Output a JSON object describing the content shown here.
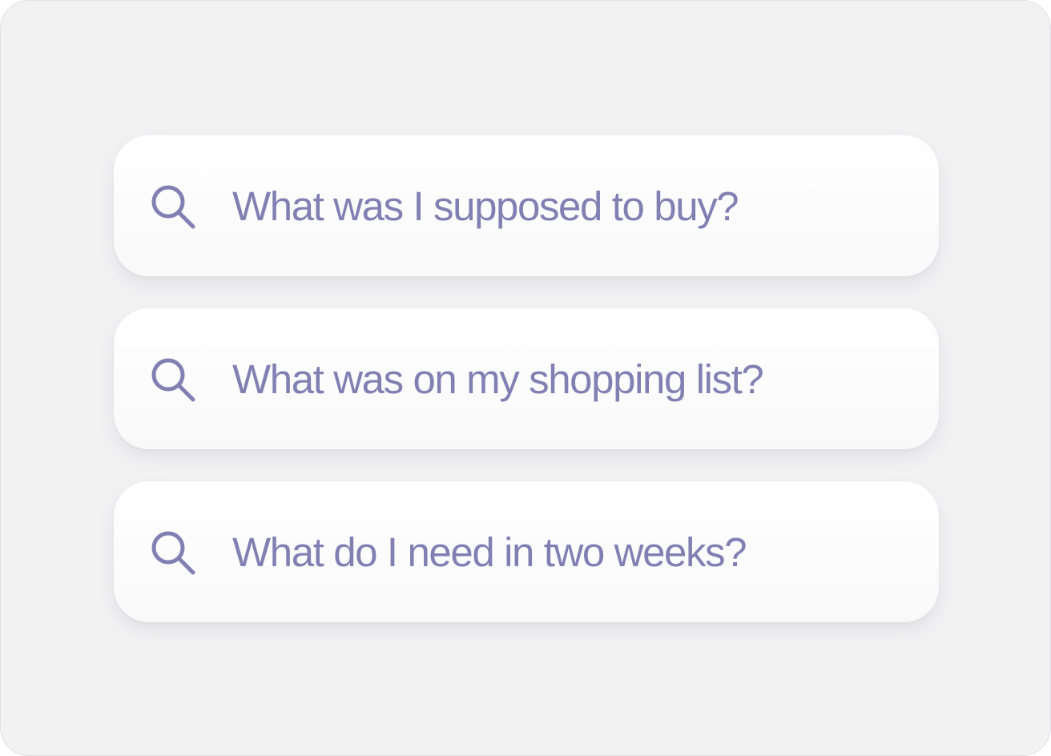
{
  "accent_color": "#8180b3",
  "searches": [
    {
      "icon": "search-icon",
      "query": "What was I supposed to buy?"
    },
    {
      "icon": "search-icon",
      "query": "What was on my shopping list?"
    },
    {
      "icon": "search-icon",
      "query": "What do I need in two weeks?"
    }
  ]
}
